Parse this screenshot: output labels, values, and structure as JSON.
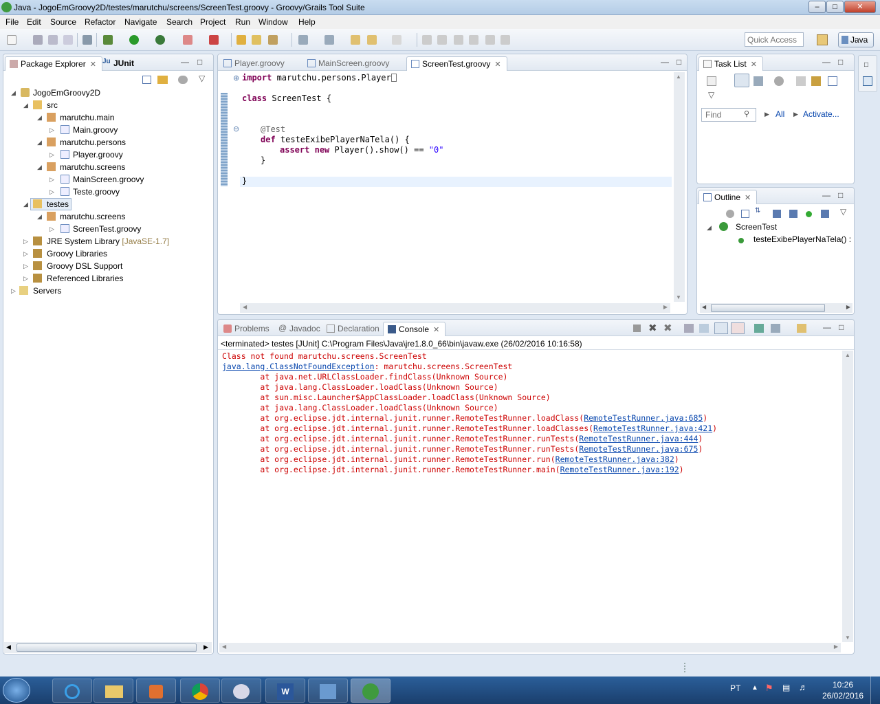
{
  "window": {
    "title": "Java - JogoEmGroovy2D/testes/marutchu/screens/ScreenTest.groovy - Groovy/Grails Tool Suite",
    "min_icon": "minimize-icon",
    "max_icon": "maximize-icon",
    "close_icon": "close-icon"
  },
  "menu": [
    "File",
    "Edit",
    "Source",
    "Refactor",
    "Navigate",
    "Search",
    "Project",
    "Run",
    "Window",
    "Help"
  ],
  "quick_access": {
    "placeholder": "Quick Access"
  },
  "perspective": "Java",
  "package_explorer": {
    "tabs": [
      "Package Explorer",
      "JUnit"
    ],
    "tree": [
      {
        "label": "JogoEmGroovy2D",
        "icon": "project-icon"
      },
      {
        "label": "src",
        "icon": "source-folder-icon"
      },
      {
        "label": "marutchu.main",
        "icon": "package-icon"
      },
      {
        "label": "Main.groovy",
        "icon": "groovy-file-icon"
      },
      {
        "label": "marutchu.persons",
        "icon": "package-icon"
      },
      {
        "label": "Player.groovy",
        "icon": "groovy-file-icon"
      },
      {
        "label": "marutchu.screens",
        "icon": "package-icon"
      },
      {
        "label": "MainScreen.groovy",
        "icon": "groovy-file-icon"
      },
      {
        "label": "Teste.groovy",
        "icon": "groovy-file-icon"
      },
      {
        "label": "testes",
        "icon": "source-folder-icon"
      },
      {
        "label": "marutchu.screens",
        "icon": "package-icon"
      },
      {
        "label": "ScreenTest.groovy",
        "icon": "groovy-file-icon"
      },
      {
        "label": "JRE System Library",
        "suffix": "[JavaSE-1.7]",
        "icon": "library-icon"
      },
      {
        "label": "Groovy Libraries",
        "icon": "library-icon"
      },
      {
        "label": "Groovy DSL Support",
        "icon": "library-icon"
      },
      {
        "label": "Referenced Libraries",
        "icon": "library-icon"
      },
      {
        "label": "Servers",
        "icon": "folder-icon"
      }
    ]
  },
  "editor": {
    "tabs": [
      "Player.groovy",
      "MainScreen.groovy",
      "ScreenTest.groovy"
    ],
    "active_tab": "ScreenTest.groovy",
    "code": {
      "import_kw": "import",
      "import_rest": " marutchu.persons.Player",
      "class_kw": "class",
      "class_rest": " ScreenTest {",
      "annotation": "@Test",
      "def_kw": "def",
      "def_rest": " testeExibePlayerNaTela() {",
      "assert_kw": "assert",
      "new_kw": "new",
      "assert_mid": " Player().show() == ",
      "assert_str": "\"0\"",
      "close_method": "}",
      "close_class": "}"
    }
  },
  "task_list": {
    "title": "Task List",
    "find_placeholder": "Find",
    "all": "All",
    "activate": "Activate..."
  },
  "outline": {
    "title": "Outline",
    "class_name": "ScreenTest",
    "method": "testeExibePlayerNaTela() : C"
  },
  "bottom": {
    "tabs": [
      "Problems",
      "Javadoc",
      "Declaration",
      "Console"
    ],
    "active_tab": "Console",
    "status": "<terminated> testes [JUnit] C:\\Program Files\\Java\\jre1.8.0_66\\bin\\javaw.exe (26/02/2016 10:16:58)",
    "lines": [
      {
        "text": "Class not found marutchu.screens.ScreenTest"
      },
      {
        "link": "java.lang.ClassNotFoundException",
        "text": ": marutchu.screens.ScreenTest"
      },
      {
        "text": "\tat java.net.URLClassLoader.findClass(Unknown Source)"
      },
      {
        "text": "\tat java.lang.ClassLoader.loadClass(Unknown Source)"
      },
      {
        "text": "\tat sun.misc.Launcher$AppClassLoader.loadClass(Unknown Source)"
      },
      {
        "text": "\tat java.lang.ClassLoader.loadClass(Unknown Source)"
      },
      {
        "text": "\tat org.eclipse.jdt.internal.junit.runner.RemoteTestRunner.loadClass(",
        "link": "RemoteTestRunner.java:685",
        "tail": ")"
      },
      {
        "text": "\tat org.eclipse.jdt.internal.junit.runner.RemoteTestRunner.loadClasses(",
        "link": "RemoteTestRunner.java:421",
        "tail": ")"
      },
      {
        "text": "\tat org.eclipse.jdt.internal.junit.runner.RemoteTestRunner.runTests(",
        "link": "RemoteTestRunner.java:444",
        "tail": ")"
      },
      {
        "text": "\tat org.eclipse.jdt.internal.junit.runner.RemoteTestRunner.runTests(",
        "link": "RemoteTestRunner.java:675",
        "tail": ")"
      },
      {
        "text": "\tat org.eclipse.jdt.internal.junit.runner.RemoteTestRunner.run(",
        "link": "RemoteTestRunner.java:382",
        "tail": ")"
      },
      {
        "text": "\tat org.eclipse.jdt.internal.junit.runner.RemoteTestRunner.main(",
        "link": "RemoteTestRunner.java:192",
        "tail": ")"
      }
    ]
  },
  "taskbar": {
    "lang": "PT",
    "time": "10:26",
    "date": "26/02/2016",
    "apps": [
      "internet-explorer-icon",
      "file-explorer-icon",
      "media-player-icon",
      "chrome-icon",
      "paint-icon",
      "word-icon",
      "control-panel-icon",
      "groovy-grails-icon"
    ]
  },
  "colors": {
    "keyword": "#7f0055",
    "string": "#2a00ff",
    "error": "#cc0000",
    "link": "#0645ad"
  }
}
